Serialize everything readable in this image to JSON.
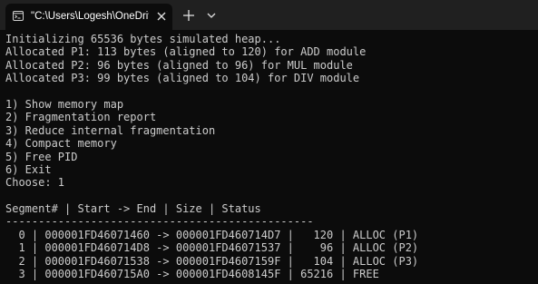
{
  "tab": {
    "title": "\"C:\\Users\\Logesh\\OneDrive\\D",
    "icon": "terminal-icon",
    "close_icon": "close-icon"
  },
  "titlebar": {
    "new_tab_icon": "plus-icon",
    "dropdown_icon": "chevron-down-icon"
  },
  "console": {
    "lines": [
      "Initializing 65536 bytes simulated heap...",
      "Allocated P1: 113 bytes (aligned to 120) for ADD module",
      "Allocated P2: 96 bytes (aligned to 96) for MUL module",
      "Allocated P3: 99 bytes (aligned to 104) for DIV module",
      "",
      "1) Show memory map",
      "2) Fragmentation report",
      "3) Reduce internal fragmentation",
      "4) Compact memory",
      "5) Free PID",
      "6) Exit",
      "Choose: 1",
      "",
      "Segment# | Start -> End | Size | Status",
      "-----------------------------------------------",
      "  0 | 000001FD46071460 -> 000001FD460714D7 |   120 | ALLOC (P1)",
      "  1 | 000001FD460714D8 -> 000001FD46071537 |    96 | ALLOC (P2)",
      "  2 | 000001FD46071538 -> 000001FD4607159F |   104 | ALLOC (P3)",
      "  3 | 000001FD460715A0 -> 000001FD4608145F | 65216 | FREE"
    ]
  },
  "colors": {
    "background": "#0c0c0c",
    "titlebar": "#202020",
    "text": "#cccccc"
  }
}
